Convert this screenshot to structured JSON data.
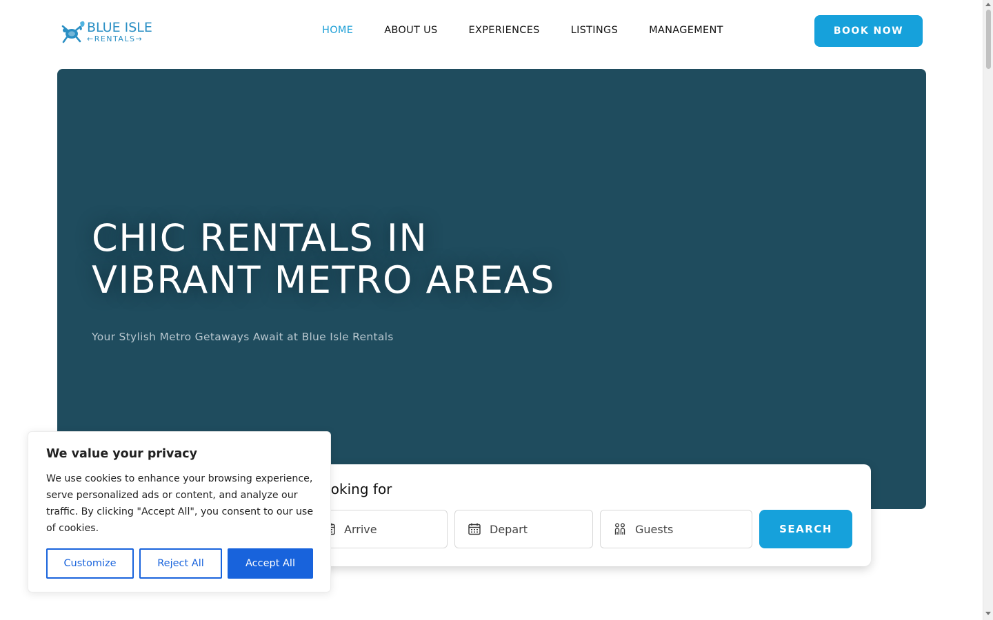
{
  "brand": {
    "logo_line1": "BLUE ISLE",
    "logo_line2": "←RENTALS→",
    "accent_color": "#16a1db",
    "icon": "turtle-butterfly-logo-icon"
  },
  "nav": {
    "items": [
      {
        "label": "HOME",
        "active": true
      },
      {
        "label": "ABOUT US"
      },
      {
        "label": "EXPERIENCES"
      },
      {
        "label": "LISTINGS"
      },
      {
        "label": "MANAGEMENT"
      }
    ],
    "book_label": "BOOK NOW"
  },
  "hero": {
    "title_line1": "CHIC RENTALS IN",
    "title_line2": "VIBRANT METRO AREAS",
    "subtitle": "Your Stylish Metro Getaways Await at Blue Isle Rentals",
    "background_color": "#1f4c5e"
  },
  "search": {
    "title": "looking for",
    "arrive_placeholder": "Arrive",
    "depart_placeholder": "Depart",
    "guests_placeholder": "Guests",
    "button_label": "SEARCH",
    "icons": [
      "calendar-icon",
      "calendar-icon",
      "guests-icon"
    ]
  },
  "cookie": {
    "title": "We value your privacy",
    "text": "We use cookies to enhance your browsing experience, serve personalized ads or content, and analyze our traffic. By clicking \"Accept All\", you consent to our use of cookies.",
    "customize_label": "Customize",
    "reject_label": "Reject All",
    "accept_label": "Accept All",
    "button_color": "#1863dc"
  }
}
